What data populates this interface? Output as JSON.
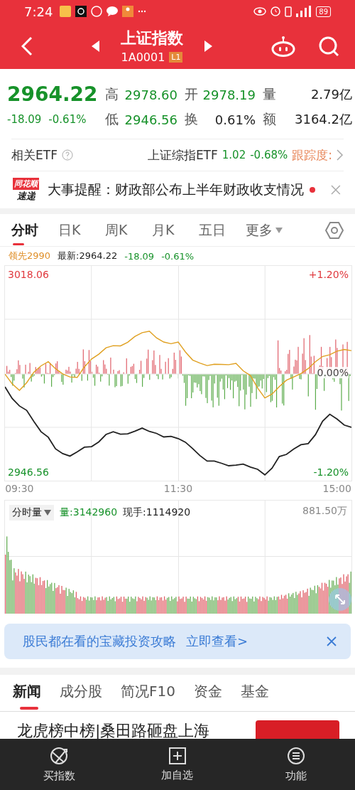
{
  "status_bar": {
    "time": "7:24",
    "battery": "89"
  },
  "header": {
    "title": "上证指数",
    "code": "1A0001",
    "badge": "L1"
  },
  "quote": {
    "price": "2964.22",
    "change": "-18.09",
    "change_pct": "-0.61%",
    "stats": [
      {
        "label": "高",
        "value": "2978.60",
        "kind": "down"
      },
      {
        "label": "开",
        "value": "2978.19",
        "kind": "down"
      },
      {
        "label": "量",
        "value": "2.79亿",
        "kind": "neutral"
      },
      {
        "label": "低",
        "value": "2946.56",
        "kind": "down"
      },
      {
        "label": "换",
        "value": "0.61%",
        "kind": "neutral"
      },
      {
        "label": "额",
        "value": "3164.2亿",
        "kind": "neutral"
      }
    ]
  },
  "etf": {
    "label": "相关ETF",
    "name": "上证综指ETF",
    "price": "1.02",
    "change_pct": "-0.68%",
    "tracking": "跟踪度:"
  },
  "alert": {
    "brand_top": "同花顺",
    "brand_bottom": "速递",
    "text": "大事提醒：财政部公布上半年财政收支情况",
    "unread": true
  },
  "chart_tabs": [
    {
      "label": "分时",
      "selected": true
    },
    {
      "label": "日K",
      "selected": false
    },
    {
      "label": "周K",
      "selected": false
    },
    {
      "label": "月K",
      "selected": false
    },
    {
      "label": "五日",
      "selected": false
    }
  ],
  "more_tab": "更多",
  "info": {
    "lead": "领先2990",
    "latest": "最新:2964.22",
    "change": "-18.09",
    "change_pct": "-0.61%"
  },
  "chart": {
    "max_pct": "+1.20%",
    "min_pct": "-1.20%",
    "zero_pct": "0.00%",
    "chart_data": {
      "type": "line",
      "categories": [
        null,
        null,
        "09:30",
        null,
        null,
        null,
        null,
        null,
        null,
        null,
        null,
        null,
        null,
        null,
        null,
        null,
        null,
        null,
        null,
        null,
        null,
        null,
        null,
        null,
        "11:30",
        null,
        null,
        null,
        null,
        null,
        null,
        null,
        null,
        null,
        null,
        null,
        null,
        null,
        null,
        null,
        null,
        null,
        null,
        null,
        null,
        null,
        "15:00",
        null,
        null
      ],
      "ylim": [
        2943.5,
        3021.1
      ],
      "yticks": [
        {
          "value": 3018.06,
          "label": "3018.06"
        },
        {
          "value": 2946.56,
          "label": "2946.56"
        }
      ],
      "series": [
        {
          "color": "#222222",
          "values": [
            2977.4,
            2973.2,
            2970.5,
            2968.9,
            2964.9,
            2961.2,
            2959.2,
            2955.0,
            2953.3,
            2952.4,
            2953.9,
            2955.6,
            2955.8,
            2957.5,
            2960.2,
            2961.2,
            2960.3,
            2960.4,
            2961.4,
            2962.5,
            2961.3,
            2960.6,
            2959.3,
            2959.5,
            2958.7,
            2957.4,
            2955.1,
            2952.6,
            2950.6,
            2950.6,
            2949.8,
            2948.9,
            2949.1,
            2949.5,
            2948.4,
            2947.6,
            2945.6,
            2948.0,
            2952.2,
            2953.0,
            2954.9,
            2956.5,
            2956.9,
            2960.1,
            2965.0,
            2967.5,
            2965.8,
            2963.6,
            2962.8
          ]
        },
        {
          "color": "#e0a020",
          "values": [
            2982.0,
            2978.5,
            2976.1,
            2978.9,
            2982.7,
            2985.0,
            2986.5,
            2984.0,
            2982.1,
            2981.0,
            2980.8,
            2984.6,
            2987.5,
            2989.2,
            2991.5,
            2992.3,
            2992.2,
            2993.5,
            2995.6,
            2997.0,
            2997.5,
            2995.1,
            2993.6,
            2993.0,
            2993.6,
            2990.0,
            2987.1,
            2986.0,
            2985.1,
            2985.6,
            2985.5,
            2985.4,
            2985.9,
            2983.2,
            2981.5,
            2977.0,
            2973.4,
            2974.8,
            2977.5,
            2979.8,
            2981.0,
            2982.2,
            2984.0,
            2986.5,
            2988.4,
            2989.0,
            2990.3,
            2990.9,
            2990.5
          ]
        }
      ]
    }
  },
  "volume": {
    "selector": "分时量",
    "volume_key": "量:",
    "volume_value": "3142960",
    "current": "现手:1114920",
    "max": "881.50万"
  },
  "banner": {
    "text": "股民都在看的宝藏投资攻略",
    "link": "立即查看>"
  },
  "news_tabs": [
    {
      "label": "新闻",
      "selected": true
    },
    {
      "label": "成分股",
      "selected": false
    },
    {
      "label": "简况F10",
      "selected": false
    },
    {
      "label": "资金",
      "selected": false
    },
    {
      "label": "基金",
      "selected": false
    }
  ],
  "headline": "龙虎榜中榜|桑田路砸盘上海",
  "bottom_nav": [
    {
      "label": "买指数",
      "kind": "buy"
    },
    {
      "label": "加自选",
      "kind": "add"
    },
    {
      "label": "功能",
      "kind": "menu"
    }
  ]
}
